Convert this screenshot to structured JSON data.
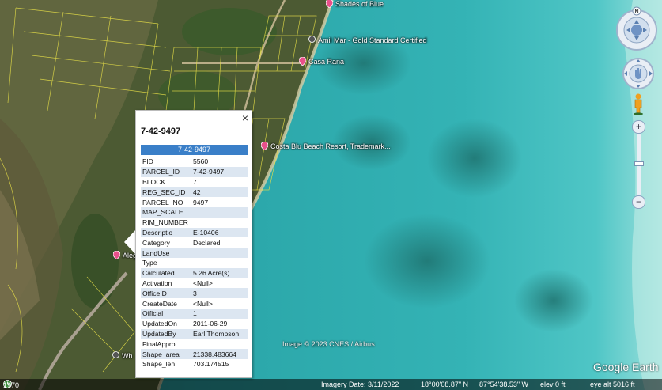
{
  "places": [
    {
      "label": "Shades of Blue",
      "name": "place-shades-of-blue",
      "icon": "pin-icon"
    },
    {
      "label": "Amil Mar - Gold Standard Certified",
      "name": "place-amil-mar",
      "icon": "pin-icon"
    },
    {
      "label": "Casa Rana",
      "name": "place-casa-rana",
      "icon": "pin-icon"
    },
    {
      "label": "Costa Blu Beach Resort, Trademark...",
      "name": "place-costa-blu",
      "icon": "pin-icon"
    },
    {
      "label": "Aleg",
      "name": "place-aleg",
      "icon": "pin-icon"
    },
    {
      "label": "Wh",
      "name": "place-wh",
      "icon": "pin-icon"
    }
  ],
  "popup": {
    "title": "7-42-9497",
    "header": "7-42-9497",
    "close_icon": "×",
    "rows": [
      {
        "key": "FID",
        "value": "5560"
      },
      {
        "key": "PARCEL_ID",
        "value": "7-42-9497"
      },
      {
        "key": "BLOCK",
        "value": "7"
      },
      {
        "key": "REG_SEC_ID",
        "value": "42"
      },
      {
        "key": "PARCEL_NO",
        "value": "9497"
      },
      {
        "key": "MAP_SCALE",
        "value": ""
      },
      {
        "key": "RIM_NUMBER",
        "value": ""
      },
      {
        "key": "Descriptio",
        "value": "E-10406"
      },
      {
        "key": "Category",
        "value": "Declared"
      },
      {
        "key": "LandUse",
        "value": ""
      },
      {
        "key": "Type",
        "value": ""
      },
      {
        "key": "Calculated",
        "value": "5.26 Acre(s)"
      },
      {
        "key": "Activation",
        "value": "<Null>"
      },
      {
        "key": "OfficeID",
        "value": "3"
      },
      {
        "key": "CreateDate",
        "value": "<Null>"
      },
      {
        "key": "Official",
        "value": "1"
      },
      {
        "key": "UpdatedOn",
        "value": "2011-06-29"
      },
      {
        "key": "UpdatedBy",
        "value": "Earl Thompson"
      },
      {
        "key": "FinalAppro",
        "value": ""
      },
      {
        "key": "Shape_area",
        "value": "21338.483664"
      },
      {
        "key": "Shape_len",
        "value": "703.174515"
      }
    ]
  },
  "controls": {
    "north": "N",
    "zoom_in": "+",
    "zoom_out": "−"
  },
  "status": {
    "year": "1970",
    "imagery_date": "Imagery Date: 3/11/2022",
    "lat": "18°00'08.87\" N",
    "lon": "87°54'38.53\" W",
    "elev": "elev      0 ft",
    "eye_alt": "eye alt   5016 ft"
  },
  "copyright": "Image © 2023 CNES / Airbus",
  "brand": "Google Earth",
  "colors": {
    "water": "#2aa3a6",
    "land": "#4a5a35",
    "parcel_lines": "#e8e048",
    "header": "#3a7fc8",
    "row_alt": "#dce6f1",
    "pin": "#e8508a"
  }
}
